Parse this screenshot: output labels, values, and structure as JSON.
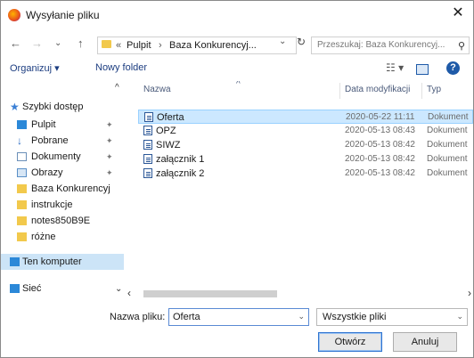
{
  "window": {
    "title": "Wysyłanie pliku"
  },
  "nav": {
    "back": "←",
    "forward": "→",
    "recent": "⌄",
    "up": "↑",
    "crumb_prefix": "«",
    "crumb1": "Pulpit",
    "crumb_sep": "›",
    "crumb2": "Baza Konkurencyj...",
    "dropdown": "⌄",
    "refresh": "↻",
    "search_placeholder": "Przeszukaj: Baza Konkurencyj...",
    "search_icon": "⚲"
  },
  "toolbar": {
    "organize": "Organizuj ▾",
    "new_folder": "Nowy folder",
    "view": "☷ ▾",
    "help": "?"
  },
  "sidebar": {
    "items": [
      {
        "label": "Szybki dostęp",
        "icon": "star-icon",
        "color": "#3a7fd5",
        "pin": ""
      },
      {
        "label": "Pulpit",
        "icon": "desktop-icon",
        "color": "#2b88d8",
        "pin": "✦"
      },
      {
        "label": "Pobrane",
        "icon": "download-icon",
        "color": "#2b6cc4",
        "pin": "✦"
      },
      {
        "label": "Dokumenty",
        "icon": "documents-icon",
        "color": "#6b8fb8",
        "pin": "✦"
      },
      {
        "label": "Obrazy",
        "icon": "pictures-icon",
        "color": "#5a8fc7",
        "pin": "✦"
      },
      {
        "label": "Baza Konkurencyj",
        "icon": "folder-icon",
        "color": "#f2c94c",
        "pin": ""
      },
      {
        "label": "instrukcje",
        "icon": "folder-icon",
        "color": "#f2c94c",
        "pin": ""
      },
      {
        "label": "notes850B9E",
        "icon": "folder-icon",
        "color": "#f2c94c",
        "pin": ""
      },
      {
        "label": "różne",
        "icon": "folder-icon",
        "color": "#f2c94c",
        "pin": ""
      },
      {
        "label": "Ten komputer",
        "icon": "computer-icon",
        "color": "#2b88d8",
        "pin": ""
      },
      {
        "label": "Sieć",
        "icon": "network-icon",
        "color": "#2b88d8",
        "pin": ""
      }
    ]
  },
  "list": {
    "columns": {
      "name": "Nazwa",
      "sort": "^",
      "date": "Data modyfikacji",
      "type": "Typ"
    },
    "rows": [
      {
        "name": "Oferta",
        "date": "2020-05-22 11:11",
        "type": "Dokument"
      },
      {
        "name": "OPZ",
        "date": "2020-05-13 08:43",
        "type": "Dokument"
      },
      {
        "name": "SIWZ",
        "date": "2020-05-13 08:42",
        "type": "Dokument"
      },
      {
        "name": "załącznik 1",
        "date": "2020-05-13 08:42",
        "type": "Dokument"
      },
      {
        "name": "załącznik 2",
        "date": "2020-05-13 08:42",
        "type": "Dokument"
      }
    ]
  },
  "scroll": {
    "left": "‹",
    "right": "›",
    "up": "^",
    "down": "⌄"
  },
  "bottom": {
    "filename_label": "Nazwa pliku:",
    "filename_value": "Oferta",
    "filter_value": "Wszystkie pliki",
    "open": "Otwórz",
    "cancel": "Anuluj",
    "dropdown": "⌄"
  },
  "colors": {
    "accent": "#1e5aa8",
    "selection": "#cce8ff"
  }
}
